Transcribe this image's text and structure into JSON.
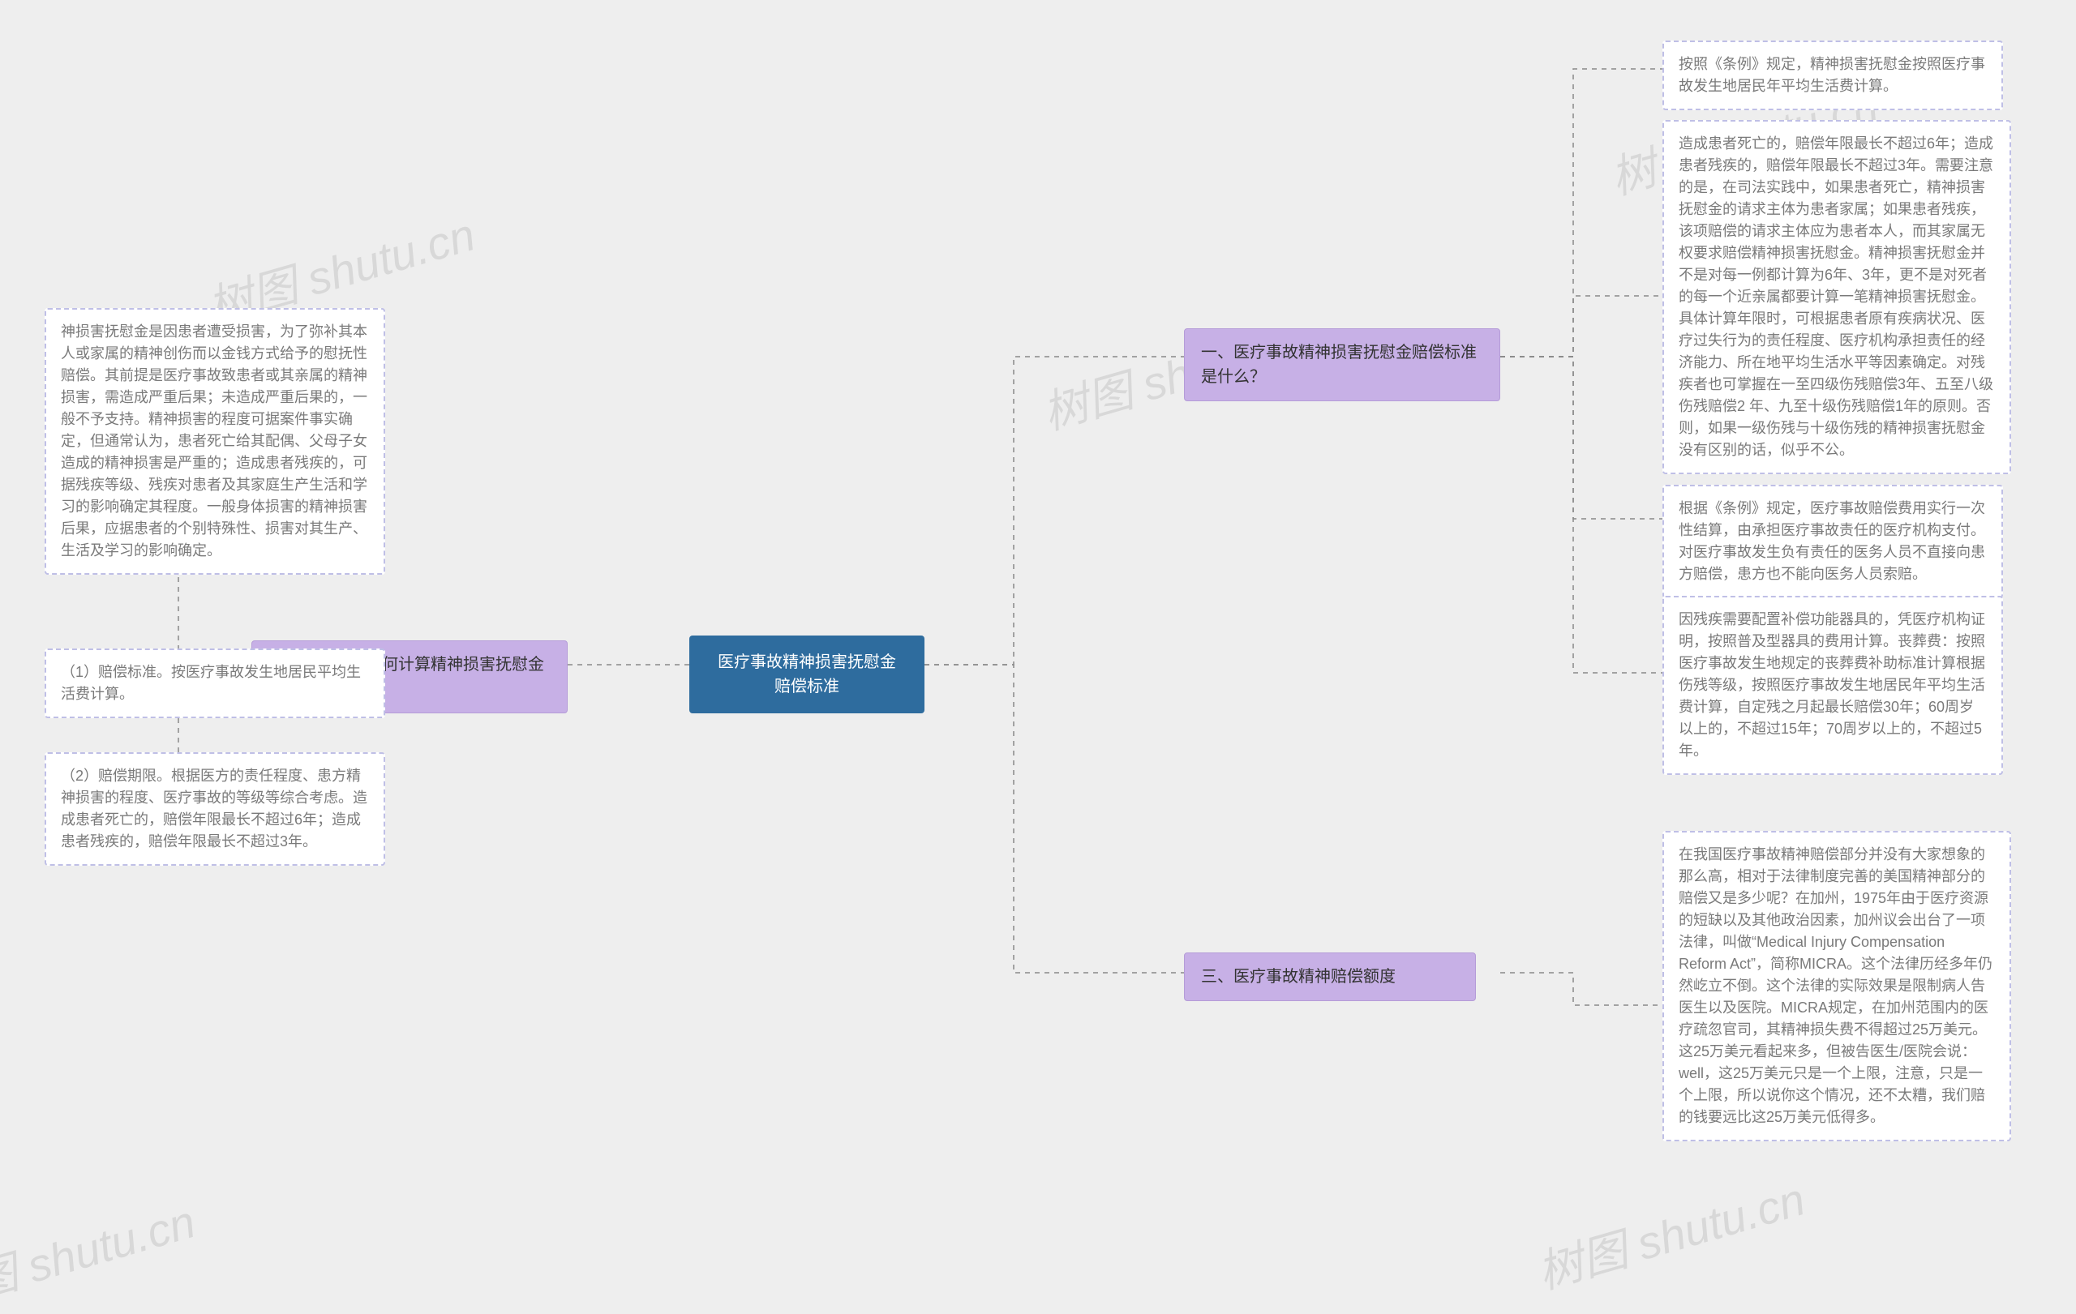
{
  "center": {
    "title": "医疗事故精神损害抚慰金赔偿标准"
  },
  "branches": {
    "b1": {
      "title": "一、医疗事故精神损害抚慰金赔偿标准是什么？",
      "leaves": {
        "l1": "按照《条例》规定，精神损害抚慰金按照医疗事故发生地居民年平均生活费计算。",
        "l2": "造成患者死亡的，赔偿年限最长不超过6年；造成患者残疾的，赔偿年限最长不超过3年。需要注意的是，在司法实践中，如果患者死亡，精神损害抚慰金的请求主体为患者家属；如果患者残疾，该项赔偿的请求主体应为患者本人，而其家属无权要求赔偿精神损害抚慰金。精神损害抚慰金并不是对每一例都计算为6年、3年，更不是对死者的每一个近亲属都要计算一笔精神损害抚慰金。具体计算年限时，可根据患者原有疾病状况、医疗过失行为的责任程度、医疗机构承担责任的经济能力、所在地平均生活水平等因素确定。对残疾者也可掌握在一至四级伤残赔偿3年、五至八级伤残赔偿2 年、九至十级伤残赔偿1年的原则。否则，如果一级伤残与十级伤残的精神损害抚慰金没有区别的话，似乎不公。",
        "l3": "根据《条例》规定，医疗事故赔偿费用实行一次性结算，由承担医疗事故责任的医疗机构支付。对医疗事故发生负有责任的医务人员不直接向患方赔偿，患方也不能向医务人员索赔。",
        "l4": "因残疾需要配置补偿功能器具的，凭医疗机构证明，按照普及型器具的费用计算。丧葬费：按照医疗事故发生地规定的丧葬费补助标准计算根据伤残等级，按照医疗事故发生地居民年平均生活费计算，自定残之月起最长赔偿30年；60周岁以上的，不超过15年；70周岁以上的，不超过5年。"
      }
    },
    "b2": {
      "title": "二、医疗事故如何计算精神损害抚慰金呢？",
      "leaves": {
        "l1": "神损害抚慰金是因患者遭受损害，为了弥补其本人或家属的精神创伤而以金钱方式给予的慰抚性赔偿。其前提是医疗事故致患者或其亲属的精神损害，需造成严重后果；未造成严重后果的，一般不予支持。精神损害的程度可据案件事实确定，但通常认为，患者死亡给其配偶、父母子女造成的精神损害是严重的；造成患者残疾的，可据残疾等级、残疾对患者及其家庭生产生活和学习的影响确定其程度。一般身体损害的精神损害后果，应据患者的个别特殊性、损害对其生产、生活及学习的影响确定。",
        "l2": "（1）赔偿标准。按医疗事故发生地居民平均生活费计算。",
        "l3": "（2）赔偿期限。根据医方的责任程度、患方精神损害的程度、医疗事故的等级等综合考虑。造成患者死亡的，赔偿年限最长不超过6年；造成患者残疾的，赔偿年限最长不超过3年。"
      }
    },
    "b3": {
      "title": "三、医疗事故精神赔偿额度",
      "leaves": {
        "l1": "在我国医疗事故精神赔偿部分并没有大家想象的那么高，相对于法律制度完善的美国精神部分的赔偿又是多少呢？在加州，1975年由于医疗资源的短缺以及其他政治因素，加州议会出台了一项法律，叫做“Medical Injury Compensation Reform Act”，简称MICRA。这个法律历经多年仍然屹立不倒。这个法律的实际效果是限制病人告医生以及医院。MICRA规定，在加州范围内的医疗疏忽官司，其精神损失费不得超过25万美元。这25万美元看起来多，但被告医生/医院会说：well，这25万美元只是一个上限，注意，只是一个上限，所以说你这个情况，还不太糟，我们赔的钱要远比这25万美元低得多。"
      }
    }
  },
  "watermarks": {
    "w1": "树图 shutu.cn",
    "w2": "树图 shutu.cn",
    "w3": "树图 shutu.cn",
    "w4": "树图 shutu.cn",
    "w5": "图 shutu.cn"
  }
}
